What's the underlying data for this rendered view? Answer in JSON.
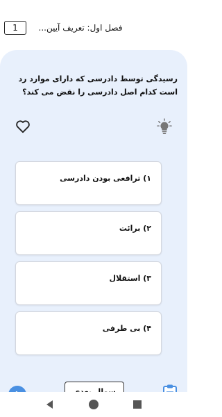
{
  "header": {
    "counter": "1",
    "chapter_title": "فصل اول: تعریف آیین..."
  },
  "question": {
    "text": "رسیدگی توسط دادرسی که دارای موارد رد است کدام اصل دادرسی را نقض می کند؟"
  },
  "options": [
    {
      "label": "۱) ترافعی بودن دادرسی"
    },
    {
      "label": "۲) برائت"
    },
    {
      "label": "۳) استقلال"
    },
    {
      "label": "۴) بی طرفی"
    }
  ],
  "footer": {
    "next_label": "سوال بعدی"
  },
  "icons": {
    "favorite": "heart-icon",
    "hint": "lightbulb-icon",
    "back": "arrow-left-icon",
    "answers": "clipboard-icon"
  },
  "colors": {
    "content_background": "#e8f0fc",
    "accent": "#4a90e2"
  }
}
